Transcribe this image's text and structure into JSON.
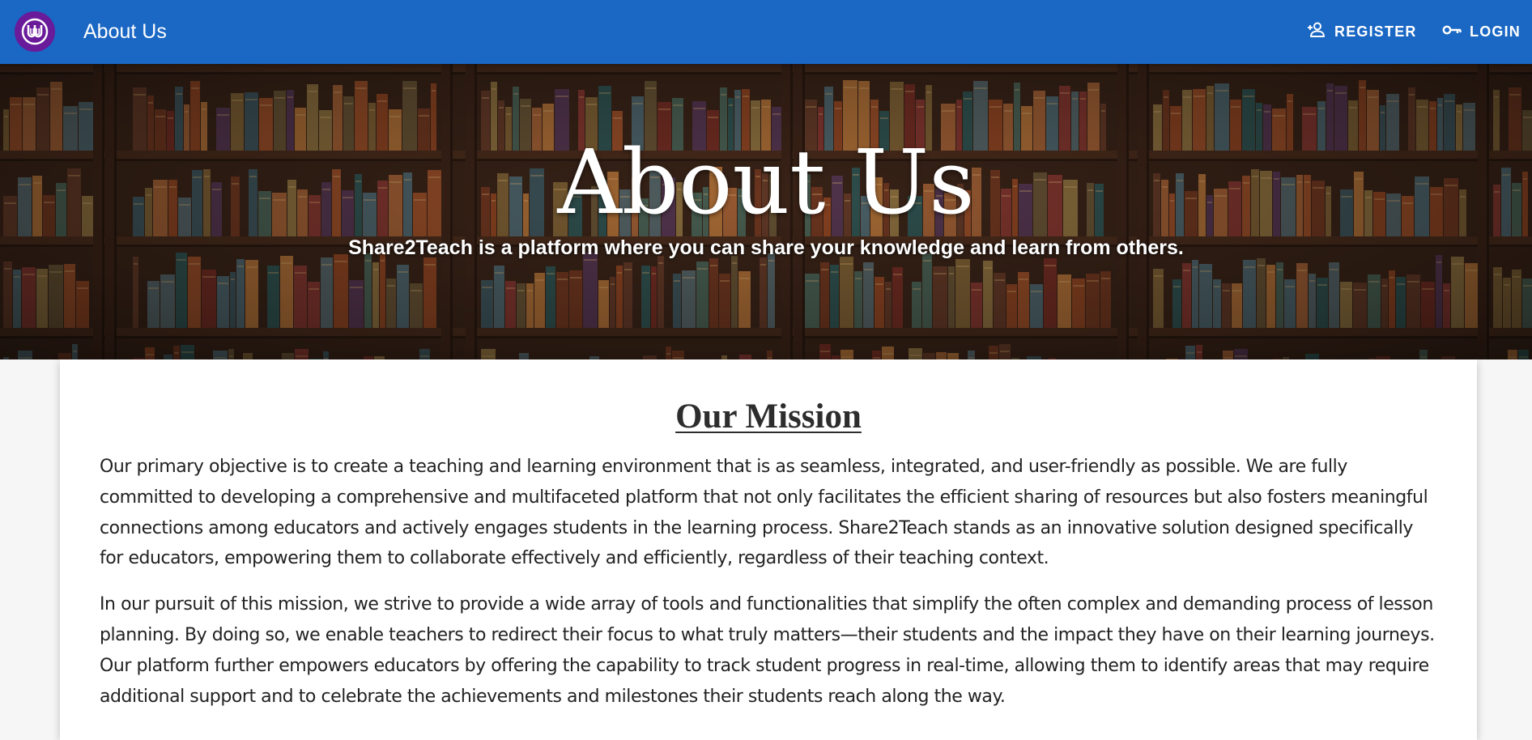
{
  "appbar": {
    "title": "About Us",
    "logo_icon": "university-logo-icon",
    "register_label": "REGISTER",
    "register_icon": "person-add-icon",
    "login_label": "LOGIN",
    "login_icon": "key-icon",
    "background_color": "#1a67c4"
  },
  "hero": {
    "title": "About Us",
    "subtitle": "Share2Teach is a platform where you can share your knowledge and learn from others."
  },
  "mission": {
    "heading": "Our Mission",
    "paragraphs": [
      "Our primary objective is to create a teaching and learning environment that is as seamless, integrated, and user-friendly as possible. We are fully committed to developing a comprehensive and multifaceted platform that not only facilitates the efficient sharing of resources but also fosters meaningful connections among educators and actively engages students in the learning process. Share2Teach stands as an innovative solution designed specifically for educators, empowering them to collaborate effectively and efficiently, regardless of their teaching context.",
      "In our pursuit of this mission, we strive to provide a wide array of tools and functionalities that simplify the often complex and demanding process of lesson planning. By doing so, we enable teachers to redirect their focus to what truly matters—their students and the impact they have on their learning journeys. Our platform further empowers educators by offering the capability to track student progress in real-time, allowing them to identify areas that may require additional support and to celebrate the achievements and milestones their students reach along the way."
    ]
  }
}
